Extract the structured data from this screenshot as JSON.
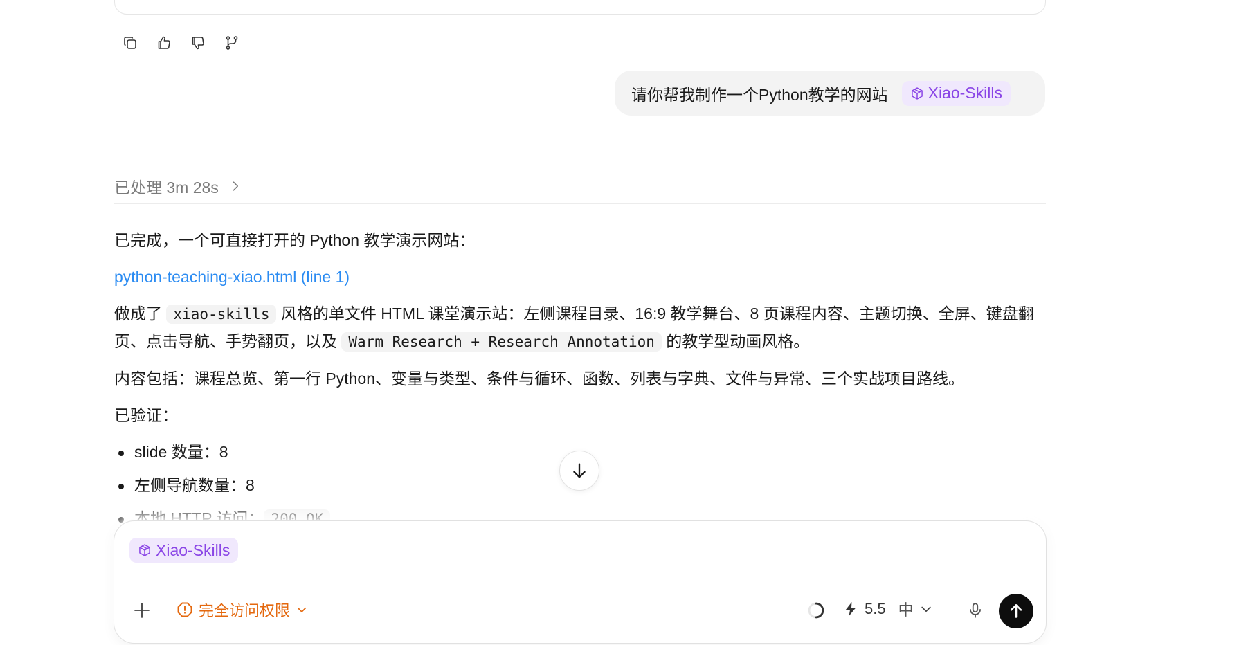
{
  "actions": {
    "icons": [
      "copy-icon",
      "thumbs-up-icon",
      "thumbs-down-icon",
      "branch-icon"
    ]
  },
  "user_message": {
    "text": "请你帮我制作一个Python教学的网站",
    "skill": "Xiao-Skills"
  },
  "processed": {
    "label": "已处理 3m 28s"
  },
  "response": {
    "intro": "已完成，一个可直接打开的 Python 教学演示网站：",
    "link": "python-teaching-xiao.html (line 1)",
    "desc_pre": "做成了 ",
    "desc_code1": "xiao-skills",
    "desc_mid": " 风格的单文件 HTML 课堂演示站：左侧课程目录、16:9 教学舞台、8 页课程内容、主题切换、全屏、键盘翻页、点击导航、手势翻页，以及 ",
    "desc_code2": "Warm Research + Research Annotation",
    "desc_post": " 的教学型动画风格。",
    "contents": "内容包括：课程总览、第一行 Python、变量与类型、条件与循环、函数、列表与字典、文件与异常、三个实战项目路线。",
    "verified_label": "已验证：",
    "checks": [
      {
        "text": "slide 数量：8"
      },
      {
        "text": "左侧导航数量：8"
      },
      {
        "text": "本地 HTTP 访问：",
        "code": "200 OK"
      }
    ]
  },
  "composer": {
    "skill": "Xiao-Skills",
    "access_label": "完全访问权限",
    "model_version": "5.5",
    "model_level": "中"
  },
  "colors": {
    "accent_purple": "#8a45e6",
    "chip_bg": "#f0e8fd",
    "link_blue": "#2a8bf2",
    "warning_orange": "#e4680e",
    "send_bg": "#0d0d0d"
  }
}
